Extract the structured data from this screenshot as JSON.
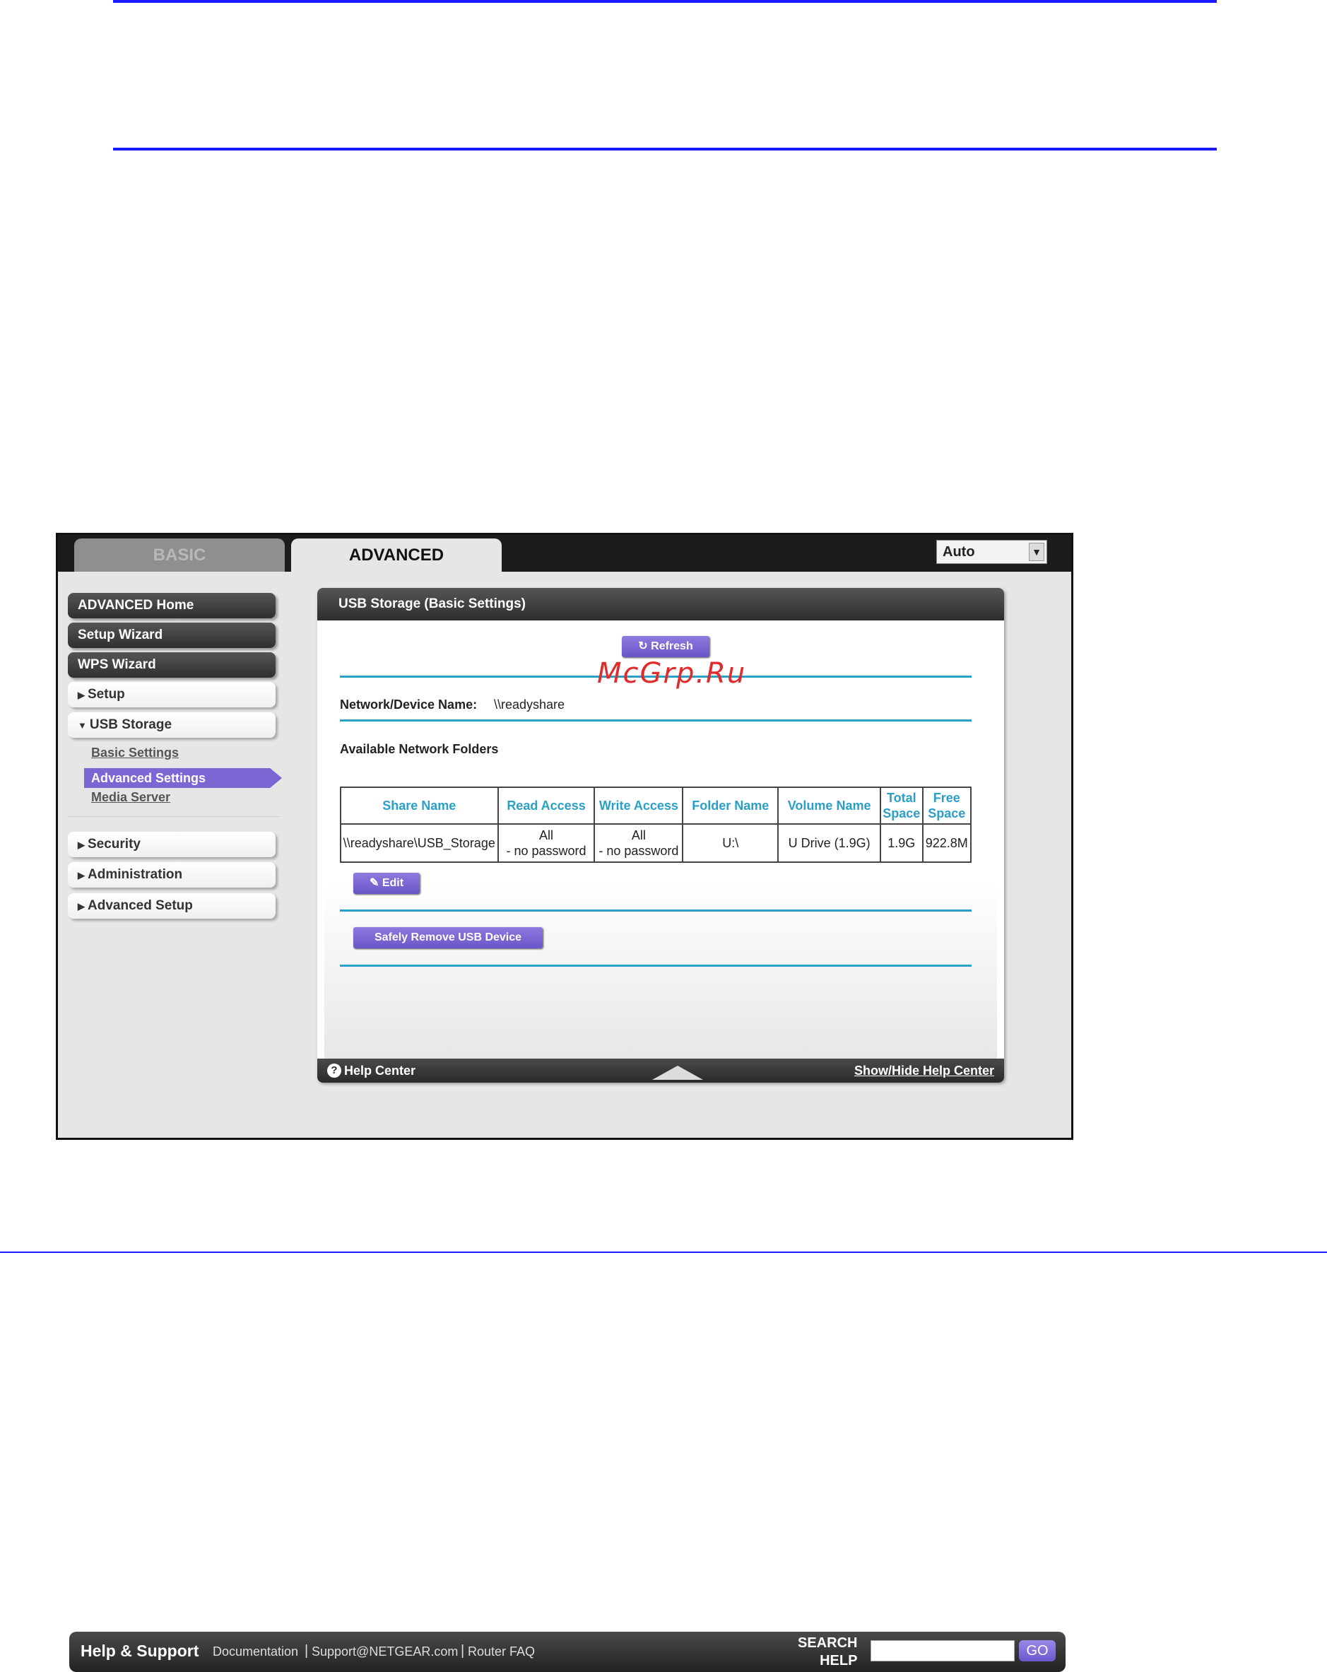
{
  "watermark": "McGrp.Ru",
  "tabs": {
    "basic": "BASIC",
    "advanced": "ADVANCED"
  },
  "language_select": {
    "value": "Auto"
  },
  "sidebar": {
    "advanced_home": "ADVANCED Home",
    "setup_wizard": "Setup Wizard",
    "wps_wizard": "WPS Wizard",
    "setup": "Setup",
    "usb_storage": "USB Storage",
    "usb_sub": {
      "basic": "Basic Settings",
      "advanced": "Advanced Settings",
      "media": "Media Server"
    },
    "security": "Security",
    "administration": "Administration",
    "advanced_setup": "Advanced Setup"
  },
  "panel": {
    "title": "USB Storage (Basic Settings)",
    "refresh_label": "Refresh",
    "device_name_label": "Network/Device Name:",
    "device_name_value": "\\\\readyshare",
    "folders_heading": "Available Network Folders",
    "table": {
      "headers": [
        "Share Name",
        "Read Access",
        "Write Access",
        "Folder Name",
        "Volume Name",
        "Total Space",
        "Free Space"
      ],
      "rows": [
        [
          "\\\\readyshare\\USB_Storage",
          "All - no password",
          "All - no password",
          "U:\\",
          "U Drive (1.9G)",
          "1.9G",
          "922.8M"
        ]
      ],
      "read_access_line1": "All",
      "read_access_line2": "- no password",
      "write_access_line1": "All",
      "write_access_line2": "- no password"
    },
    "edit_label": "Edit",
    "safely_remove_label": "Safely Remove USB Device",
    "help_center_label": "Help Center",
    "show_hide_label": "Show/Hide Help Center"
  },
  "footer": {
    "title": "Help & Support",
    "links": [
      "Documentation",
      "Support@NETGEAR.com",
      "Router FAQ"
    ],
    "search_label_1": "SEARCH",
    "search_label_2": "HELP",
    "go_label": "GO"
  },
  "colors": {
    "accent_purple": "#7c66d4",
    "table_header": "#2aa0c8",
    "rule_blue": "#1a1aff"
  }
}
